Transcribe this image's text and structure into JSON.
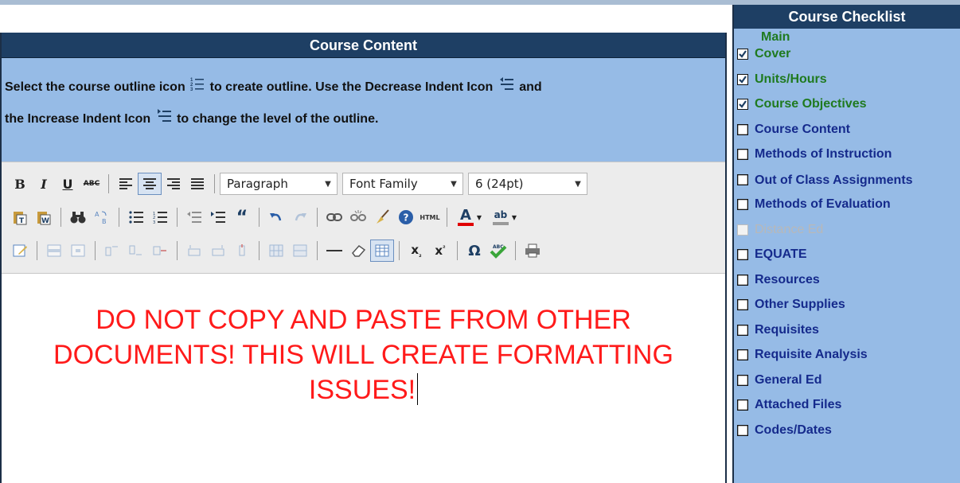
{
  "content": {
    "title": "Course Content",
    "instruction_part1": "Select the course outline icon",
    "instruction_part2": "to create outline. Use the Decrease Indent Icon",
    "instruction_part3": "and",
    "instruction_part4": "the Increase Indent Icon",
    "instruction_part5": "to change the level of the outline."
  },
  "toolbar": {
    "bold_label": "B",
    "italic_label": "I",
    "underline_label": "U",
    "strike_label": "ABC",
    "format_select": "Paragraph",
    "font_family_select": "Font Family",
    "font_size_select": "6 (24pt)",
    "html_label": "HTML",
    "quote_label": "“",
    "omega_label": "Ω",
    "abc_label": "ABC",
    "text_color_label": "A",
    "highlight_label": "ab"
  },
  "editor": {
    "text": "DO NOT COPY AND PASTE FROM OTHER DOCUMENTS! THIS WILL CREATE FORMATTING ISSUES!"
  },
  "checklist": {
    "title": "Course Checklist",
    "main_label": "Main",
    "items": [
      {
        "label": "Cover",
        "state": "checked"
      },
      {
        "label": "Units/Hours",
        "state": "checked"
      },
      {
        "label": "Course Objectives",
        "state": "checked"
      },
      {
        "label": "Course Content",
        "state": "unchecked"
      },
      {
        "label": "Methods of Instruction",
        "state": "unchecked"
      },
      {
        "label": "Out of Class Assignments",
        "state": "unchecked"
      },
      {
        "label": "Methods of Evaluation",
        "state": "unchecked"
      },
      {
        "label": "Distance Ed",
        "state": "disabled"
      },
      {
        "label": "EQUATE",
        "state": "unchecked"
      },
      {
        "label": "Resources",
        "state": "unchecked"
      },
      {
        "label": "Other Supplies",
        "state": "unchecked"
      },
      {
        "label": "Requisites",
        "state": "unchecked"
      },
      {
        "label": "Requisite Analysis",
        "state": "unchecked"
      },
      {
        "label": "General Ed",
        "state": "unchecked"
      },
      {
        "label": "Attached Files",
        "state": "unchecked"
      },
      {
        "label": "Codes/Dates",
        "state": "unchecked"
      }
    ]
  },
  "colors": {
    "header_bg": "#1e3f64",
    "panel_bg": "#96bbe6",
    "done_text": "#1f7a1f",
    "todo_text": "#152a8c",
    "editor_text": "#ff1a1a"
  }
}
